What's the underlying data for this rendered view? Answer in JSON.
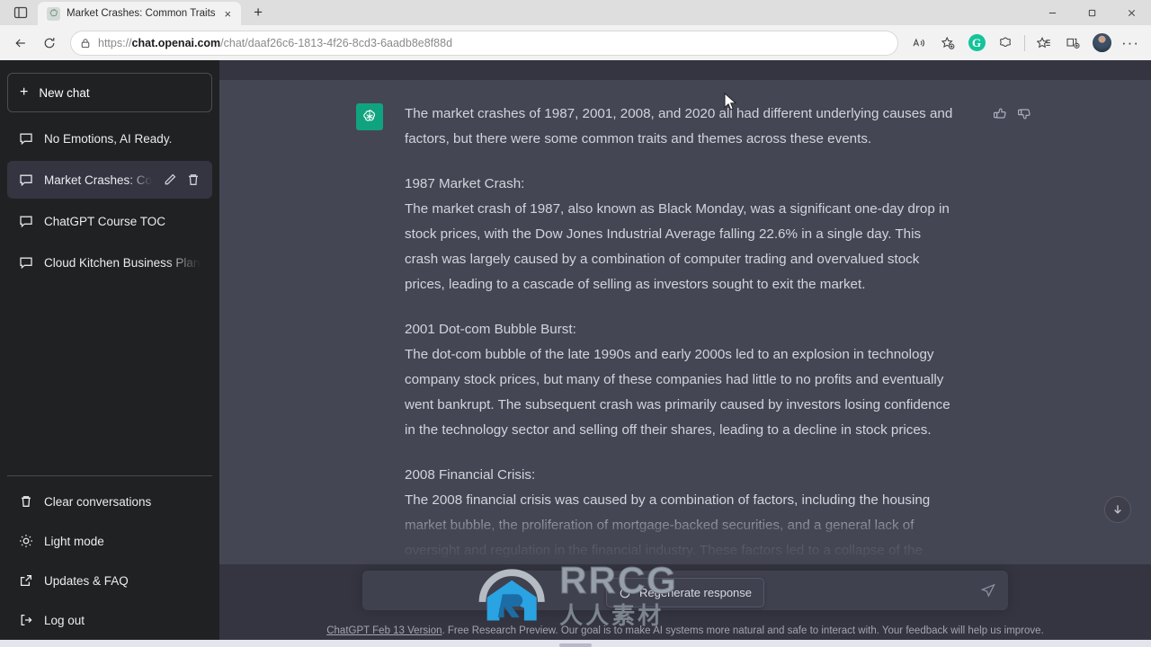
{
  "browser": {
    "tab": {
      "title": "Market Crashes: Common Traits",
      "favicon": "openai-logo-icon",
      "close_label": "×"
    },
    "new_tab_label": "+",
    "window_controls": {
      "minimize": "minimize-icon",
      "maximize": "maximize-icon",
      "close": "close-icon"
    },
    "toolbar": {
      "back": "back-arrow-icon",
      "refresh": "refresh-icon",
      "url": "https://chat.openai.com/chat/daaf26c6-1813-4f26-8cd3-6aadb8e8f88d",
      "url_domain": "chat.openai.com",
      "url_scheme": "https://",
      "url_path": "/chat/daaf26c6-1813-4f26-8cd3-6aadb8e8f88d",
      "read_aloud": "read-aloud-icon",
      "add_favorite": "add-favorite-icon",
      "grammarly": "G",
      "browser_essentials": "browser-essentials-icon",
      "collections": "collections-icon",
      "split_screen": "split-screen-icon",
      "profile": "profile-avatar",
      "settings_more": "···"
    }
  },
  "sidebar": {
    "new_chat": {
      "label": "New chat",
      "icon": "plus-icon"
    },
    "conversations": [
      {
        "label": "No Emotions, AI Ready.",
        "active": false
      },
      {
        "label": "Market Crashes: Comm",
        "active": true
      },
      {
        "label": "ChatGPT Course TOC",
        "active": false
      },
      {
        "label": "Cloud Kitchen Business Plan",
        "active": false
      }
    ],
    "active_actions": {
      "edit": "pencil-icon",
      "delete": "trash-icon"
    },
    "bottom_items": [
      {
        "label": "Clear conversations",
        "icon": "trash-icon"
      },
      {
        "label": "Light mode",
        "icon": "sun-icon"
      },
      {
        "label": "Updates & FAQ",
        "icon": "external-link-icon"
      },
      {
        "label": "Log out",
        "icon": "logout-icon"
      }
    ]
  },
  "conversation": {
    "assistant_avatar": "openai-logo-icon",
    "paragraphs": {
      "intro": "The market crashes of 1987, 2001, 2008, and 2020 all had different underlying causes and factors, but there were some common traits and themes across these events.",
      "h1987": "1987 Market Crash:",
      "p1987": "The market crash of 1987, also known as Black Monday, was a significant one-day drop in stock prices, with the Dow Jones Industrial Average falling 22.6% in a single day. This crash was largely caused by a combination of computer trading and overvalued stock prices, leading to a cascade of selling as investors sought to exit the market.",
      "h2001": "2001 Dot-com Bubble Burst:",
      "p2001": "The dot-com bubble of the late 1990s and early 2000s led to an explosion in technology company stock prices, but many of these companies had little to no profits and eventually went bankrupt. The subsequent crash was primarily caused by investors losing confidence in the technology sector and selling off their shares, leading to a decline in stock prices.",
      "h2008": "2008 Financial Crisis:",
      "p2008": "The 2008 financial crisis was caused by a combination of factors, including the housing market bubble, the proliferation of mortgage-backed securities, and a general lack of oversight and regulation in the financial industry. These factors led to a collapse of the"
    },
    "feedback": {
      "thumbs_up": "thumbs-up-icon",
      "thumbs_down": "thumbs-down-icon"
    },
    "regenerate": {
      "label": "Regenerate response",
      "icon": "refresh-icon"
    },
    "scroll_to_bottom": "down-arrow-icon"
  },
  "composer": {
    "value": "",
    "placeholder": "",
    "send_icon": "send-icon"
  },
  "footer": {
    "version_link": "ChatGPT Feb 13 Version",
    "rest": ". Free Research Preview. Our goal is to make AI systems more natural and safe to interact with. Your feedback will help us improve."
  },
  "watermark": {
    "brand": "RRCG",
    "subtitle": "人人素材"
  },
  "colors": {
    "sidebar_bg": "#202123",
    "main_bg": "#444654",
    "chat_bg": "#343541",
    "accent_green": "#10a37f",
    "text": "#d1d5db"
  }
}
